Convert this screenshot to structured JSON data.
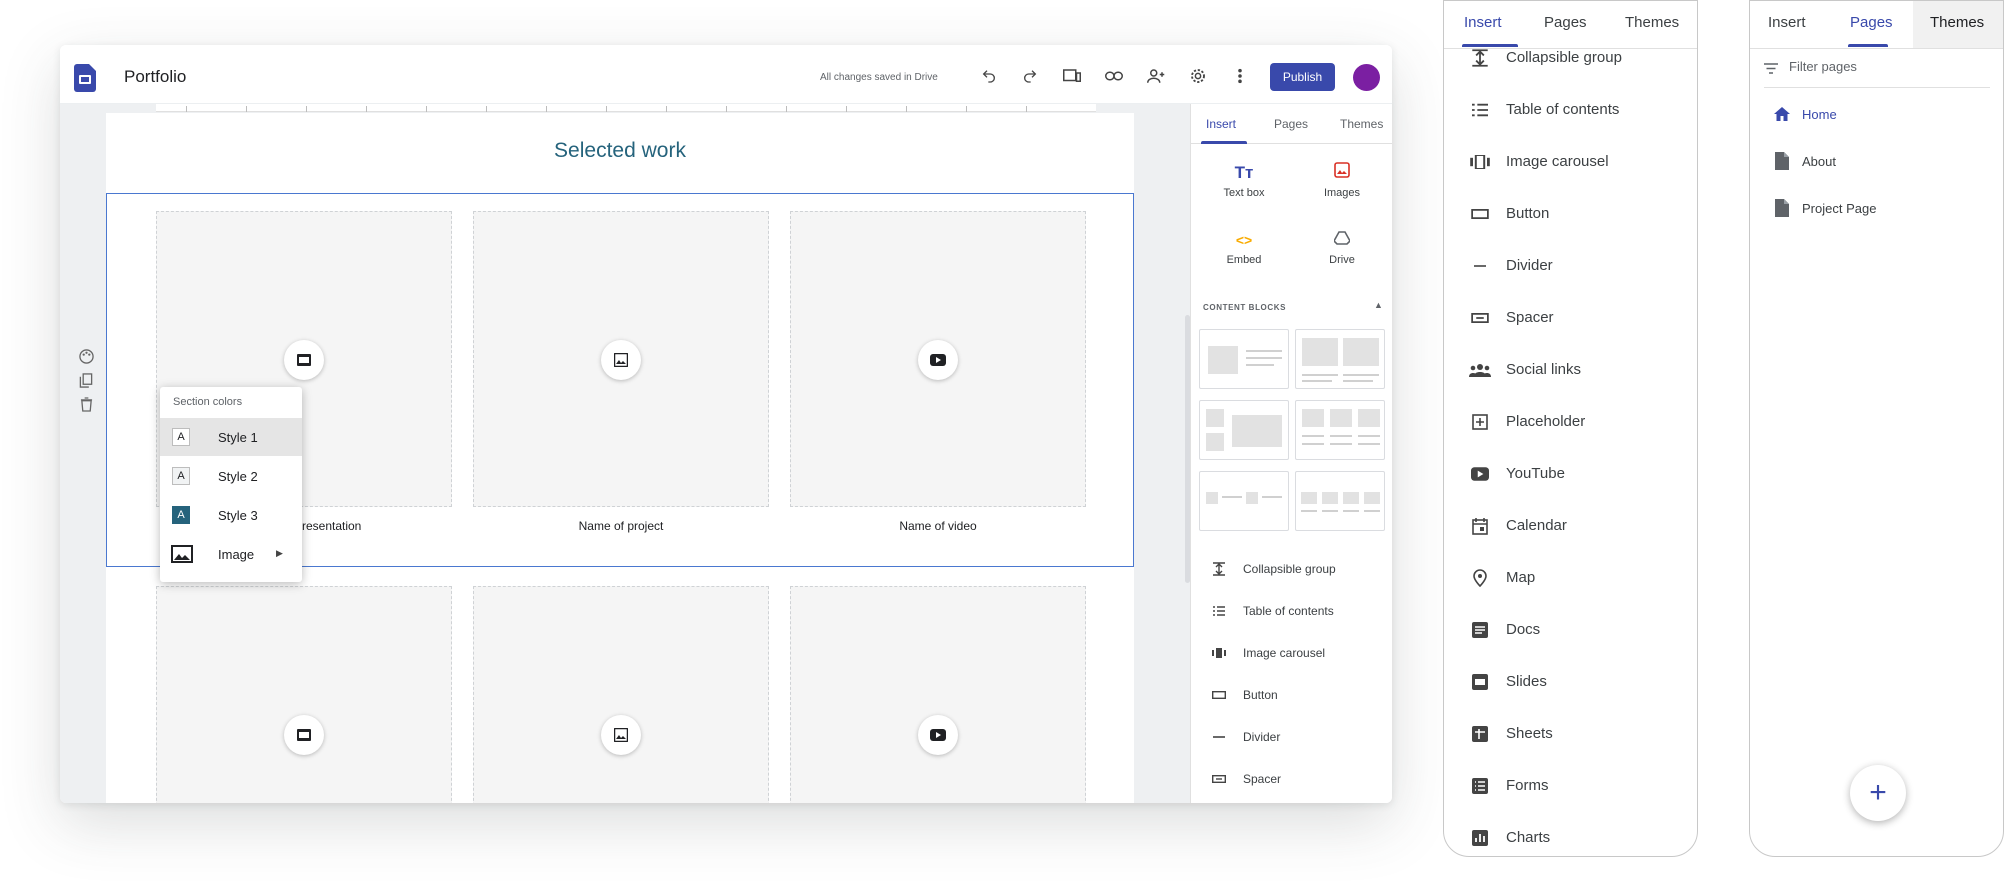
{
  "editor": {
    "doc_title": "Portfolio",
    "save_status": "All changes saved in Drive",
    "publish_label": "Publish",
    "toolbar_icons": [
      "undo-icon",
      "redo-icon",
      "preview-icon",
      "link-icon",
      "share-icon",
      "settings-icon",
      "more-icon"
    ],
    "page_title": "Selected work",
    "captions": [
      "Name of presentation",
      "Name of project",
      "Name of video"
    ]
  },
  "section_colors": {
    "title": "Section colors",
    "items": [
      {
        "swatch": "A",
        "label": "Style 1"
      },
      {
        "swatch": "A",
        "label": "Style 2"
      },
      {
        "swatch": "A",
        "label": "Style 3"
      },
      {
        "label": "Image"
      }
    ]
  },
  "insert_panel": {
    "tabs": [
      "Insert",
      "Pages",
      "Themes"
    ],
    "tools": [
      "Text box",
      "Images",
      "Embed",
      "Drive"
    ],
    "content_blocks_label": "CONTENT BLOCKS",
    "list": [
      "Collapsible group",
      "Table of contents",
      "Image carousel",
      "Button",
      "Divider",
      "Spacer"
    ]
  },
  "phone_insert": {
    "tabs": [
      "Insert",
      "Pages",
      "Themes"
    ],
    "items": [
      "Collapsible group",
      "Table of contents",
      "Image carousel",
      "Button",
      "Divider",
      "Spacer",
      "Social links",
      "Placeholder",
      "YouTube",
      "Calendar",
      "Map",
      "Docs",
      "Slides",
      "Sheets",
      "Forms",
      "Charts"
    ]
  },
  "phone_pages": {
    "tabs": [
      "Insert",
      "Pages",
      "Themes"
    ],
    "filter_placeholder": "Filter pages",
    "pages": [
      "Home",
      "About",
      "Project Page"
    ]
  },
  "colors": {
    "accent": "#3949ab",
    "title": "#25637c",
    "selection": "#4a78d0",
    "avatar": "#7b1fa2"
  }
}
